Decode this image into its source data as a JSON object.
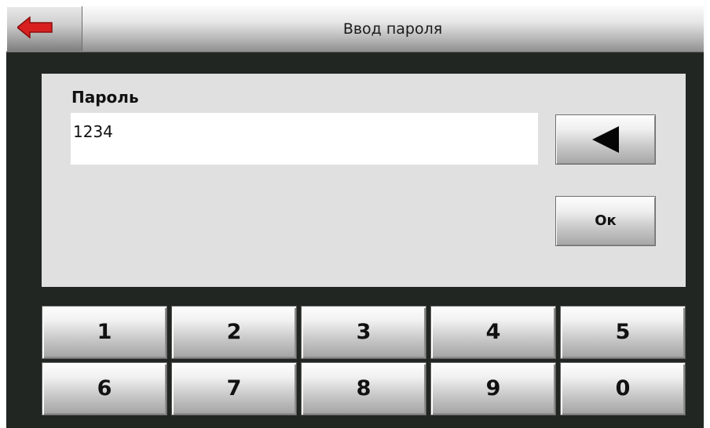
{
  "header": {
    "title": "Ввод пароля",
    "back_icon": "back-arrow-icon",
    "back_icon_color": "#d92020"
  },
  "form": {
    "password_label": "Пароль",
    "password_value": "1234",
    "backspace_icon": "backspace-triangle-icon",
    "ok_label": "Ок"
  },
  "keypad": {
    "row1": [
      "1",
      "2",
      "3",
      "4",
      "5"
    ],
    "row2": [
      "6",
      "7",
      "8",
      "9",
      "0"
    ]
  },
  "colors": {
    "background": "#222622",
    "panel": "#e0e0e0",
    "input": "#ffffff"
  }
}
